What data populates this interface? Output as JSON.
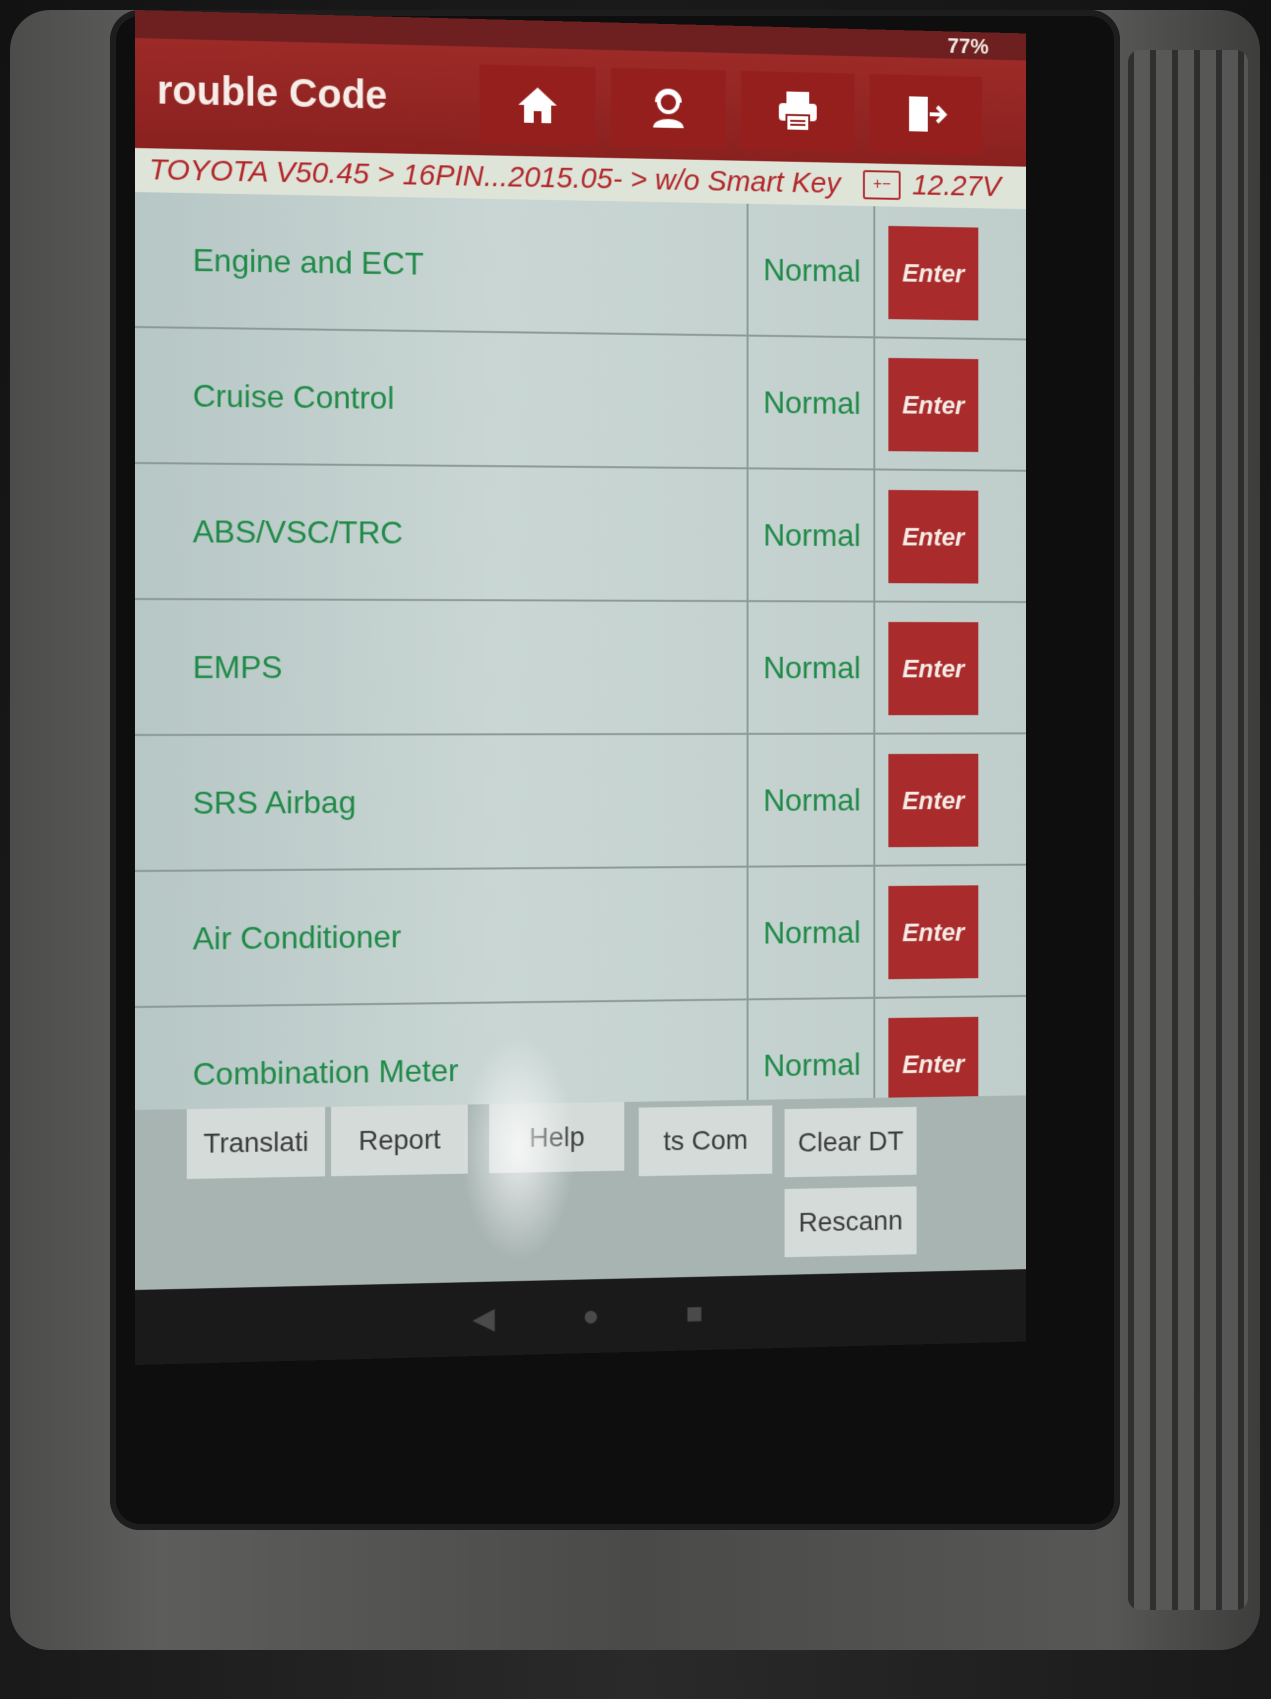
{
  "status_bar": {
    "battery": "77%"
  },
  "header": {
    "title": "rouble Code",
    "buttons": [
      {
        "name": "home",
        "icon": "home-icon"
      },
      {
        "name": "support",
        "icon": "user-headset-icon"
      },
      {
        "name": "print",
        "icon": "printer-icon"
      },
      {
        "name": "exit",
        "icon": "exit-icon"
      }
    ]
  },
  "breadcrumb": {
    "path": "TOYOTA V50.45 > 16PIN...2015.05- > w/o Smart Key",
    "battery_icon": "battery-icon",
    "voltage": "12.27V"
  },
  "systems": [
    {
      "name": "Engine and ECT",
      "status": "Normal",
      "action": "Enter"
    },
    {
      "name": "Cruise Control",
      "status": "Normal",
      "action": "Enter"
    },
    {
      "name": "ABS/VSC/TRC",
      "status": "Normal",
      "action": "Enter"
    },
    {
      "name": "EMPS",
      "status": "Normal",
      "action": "Enter"
    },
    {
      "name": "SRS Airbag",
      "status": "Normal",
      "action": "Enter"
    },
    {
      "name": "Air Conditioner",
      "status": "Normal",
      "action": "Enter"
    },
    {
      "name": "Combination Meter",
      "status": "Normal",
      "action": "Enter"
    }
  ],
  "bottom_buttons": {
    "translation": "Translati",
    "report": "Report",
    "help": "Help",
    "components": "ts    Com",
    "clear_dtc": "Clear DT",
    "rescan": "Rescann"
  },
  "colors": {
    "header_bg": "#9c2a27",
    "enter_button": "#a92b2b",
    "status_text": "#1f8a47",
    "breadcrumb_text": "#b1262a"
  }
}
